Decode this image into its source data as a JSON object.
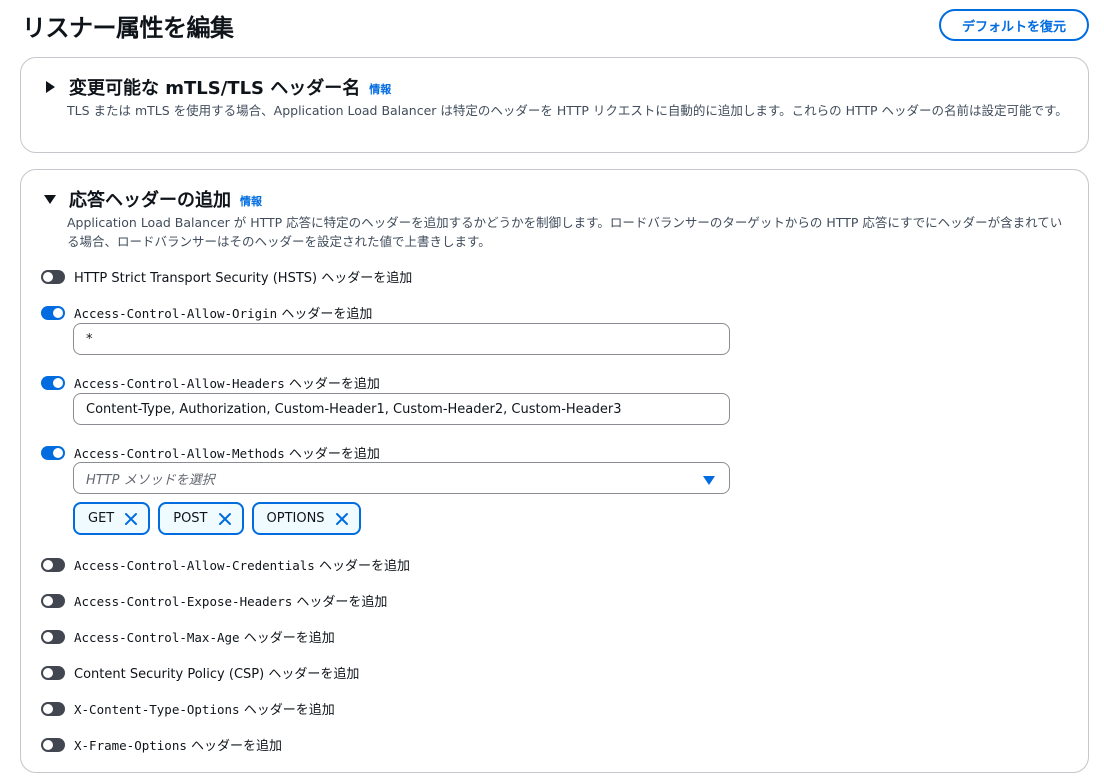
{
  "header": {
    "title": "リスナー属性を編集",
    "restore_button": "デフォルトを復元"
  },
  "mtls_section": {
    "title": "変更可能な mTLS/TLS ヘッダー名",
    "info": "情報",
    "expanded": false,
    "description": "TLS または mTLS を使用する場合、Application Load Balancer は特定のヘッダーを HTTP リクエストに自動的に追加します。これらの HTTP ヘッダーの名前は設定可能です。"
  },
  "response_section": {
    "title": "応答ヘッダーの追加",
    "info": "情報",
    "expanded": true,
    "description": "Application Load Balancer が HTTP 応答に特定のヘッダーを追加するかどうかを制御します。ロードバランサーのターゲットからの HTTP 応答にすでにヘッダーが含まれている場合、ロードバランサーはそのヘッダーを設定された値で上書きします。",
    "suffix": "ヘッダーを追加",
    "toggles": [
      {
        "name": "HTTP Strict Transport Security (HSTS)",
        "enabled": false
      },
      {
        "name": "Access-Control-Allow-Origin",
        "enabled": true
      },
      {
        "name": "Access-Control-Allow-Headers",
        "enabled": true
      },
      {
        "name": "Access-Control-Allow-Methods",
        "enabled": true
      },
      {
        "name": "Access-Control-Allow-Credentials",
        "enabled": false
      },
      {
        "name": "Access-Control-Expose-Headers",
        "enabled": false
      },
      {
        "name": "Access-Control-Max-Age",
        "enabled": false
      },
      {
        "name": "Content Security Policy (CSP)",
        "enabled": false
      },
      {
        "name": "X-Content-Type-Options",
        "enabled": false
      },
      {
        "name": "X-Frame-Options",
        "enabled": false
      }
    ],
    "allow_origin_value": "*",
    "allow_headers_value": "Content-Type, Authorization, Custom-Header1, Custom-Header2, Custom-Header3",
    "methods_placeholder": "HTTP メソッドを選択",
    "method_tokens": [
      "GET",
      "POST",
      "OPTIONS"
    ]
  },
  "colors": {
    "accent": "#006ce0",
    "toggle_off": "#424650",
    "border": "#c6c6cd"
  }
}
